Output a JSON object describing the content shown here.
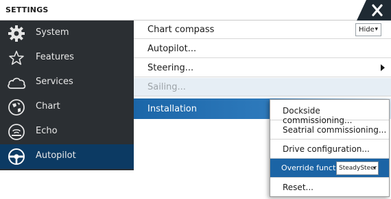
{
  "window": {
    "title": "SETTINGS"
  },
  "sidebar": {
    "items": [
      {
        "label": "System",
        "icon": "gear-icon",
        "active": false
      },
      {
        "label": "Features",
        "icon": "star-icon",
        "active": false
      },
      {
        "label": "Services",
        "icon": "cloud-icon",
        "active": false
      },
      {
        "label": "Chart",
        "icon": "chart-compass-icon",
        "active": false
      },
      {
        "label": "Echo",
        "icon": "echo-sounder-icon",
        "active": false
      },
      {
        "label": "Autopilot",
        "icon": "steering-wheel-icon",
        "active": true
      }
    ]
  },
  "main": {
    "rows": [
      {
        "label": "Chart compass",
        "control": "dropdown",
        "value": "Hide"
      },
      {
        "label": "Autopilot..."
      },
      {
        "label": "Steering...",
        "has_submenu": true
      },
      {
        "label": "Sailing...",
        "disabled": true
      },
      {
        "label": "Installation",
        "highlighted": true
      }
    ]
  },
  "submenu": {
    "items": [
      {
        "label": "Dockside commissioning..."
      },
      {
        "label": "Seatrial commissioning..."
      },
      {
        "label": "Drive configuration..."
      },
      {
        "label": "Override function",
        "value": "SteadySteer",
        "active": true
      },
      {
        "label": "Reset..."
      }
    ]
  },
  "colors": {
    "sidebar_bg": "#2b2f33",
    "active_item_bg": "#0c3a63",
    "highlight_blue": "#1b66a8",
    "close_tab_bg": "#1f2a33"
  }
}
